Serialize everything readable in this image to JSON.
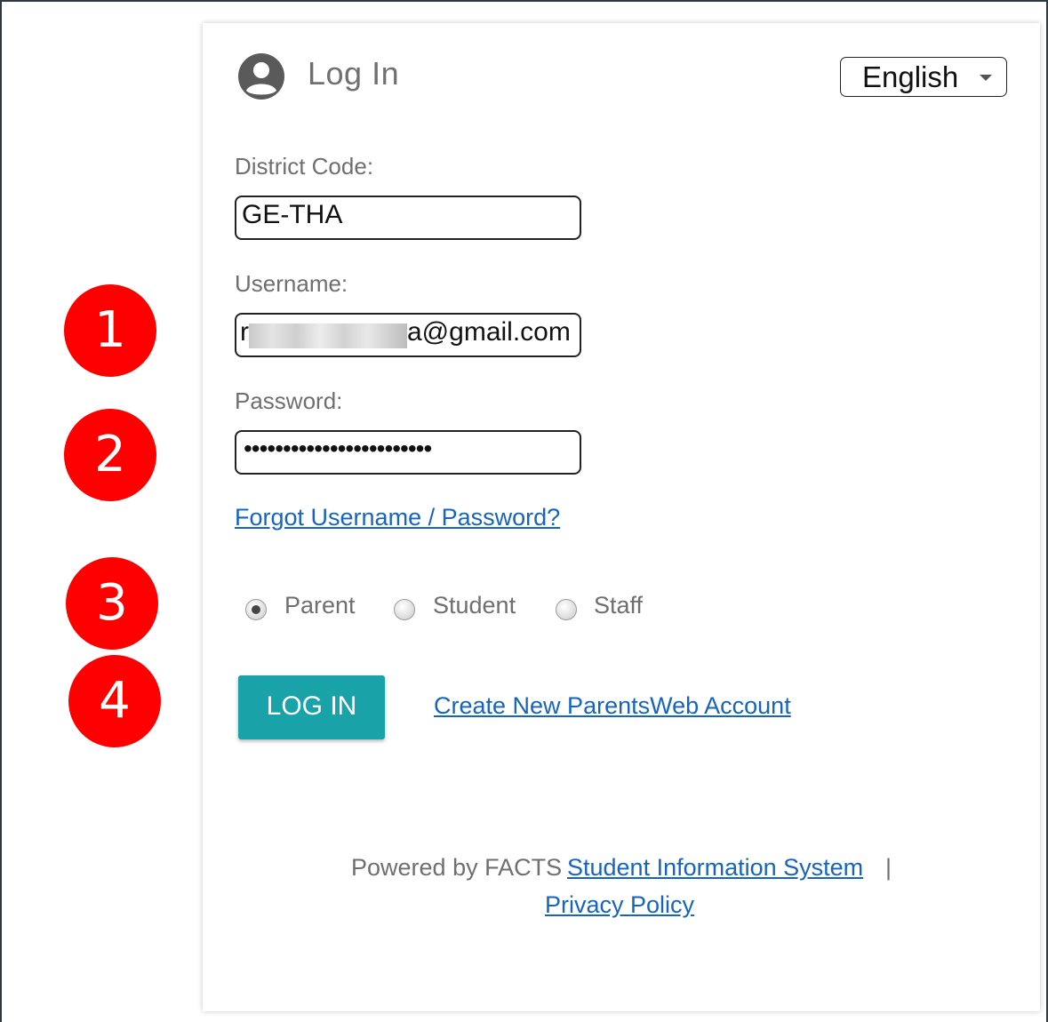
{
  "header": {
    "title": "Log In",
    "language_selected": "English"
  },
  "form": {
    "district_label": "District Code:",
    "district_value": "GE-THA",
    "username_label": "Username:",
    "username_prefix": "r",
    "username_suffix": "a@gmail.com",
    "password_label": "Password:",
    "password_masked": "••••••••••••••••••••••••",
    "forgot_link": "Forgot Username / Password?",
    "roles": [
      {
        "label": "Parent",
        "selected": true
      },
      {
        "label": "Student",
        "selected": false
      },
      {
        "label": "Staff",
        "selected": false
      }
    ],
    "login_button": "LOG IN",
    "create_account_link": "Create New ParentsWeb Account"
  },
  "footer": {
    "powered_by": "Powered by FACTS",
    "sis_link": "Student Information System",
    "separator": "|",
    "privacy_link": "Privacy Policy"
  },
  "annotations": [
    "1",
    "2",
    "3",
    "4"
  ],
  "colors": {
    "login_button": "#19a3a8",
    "link": "#1565c0",
    "badge": "#ff0000",
    "label_text": "#6f6f6f"
  }
}
